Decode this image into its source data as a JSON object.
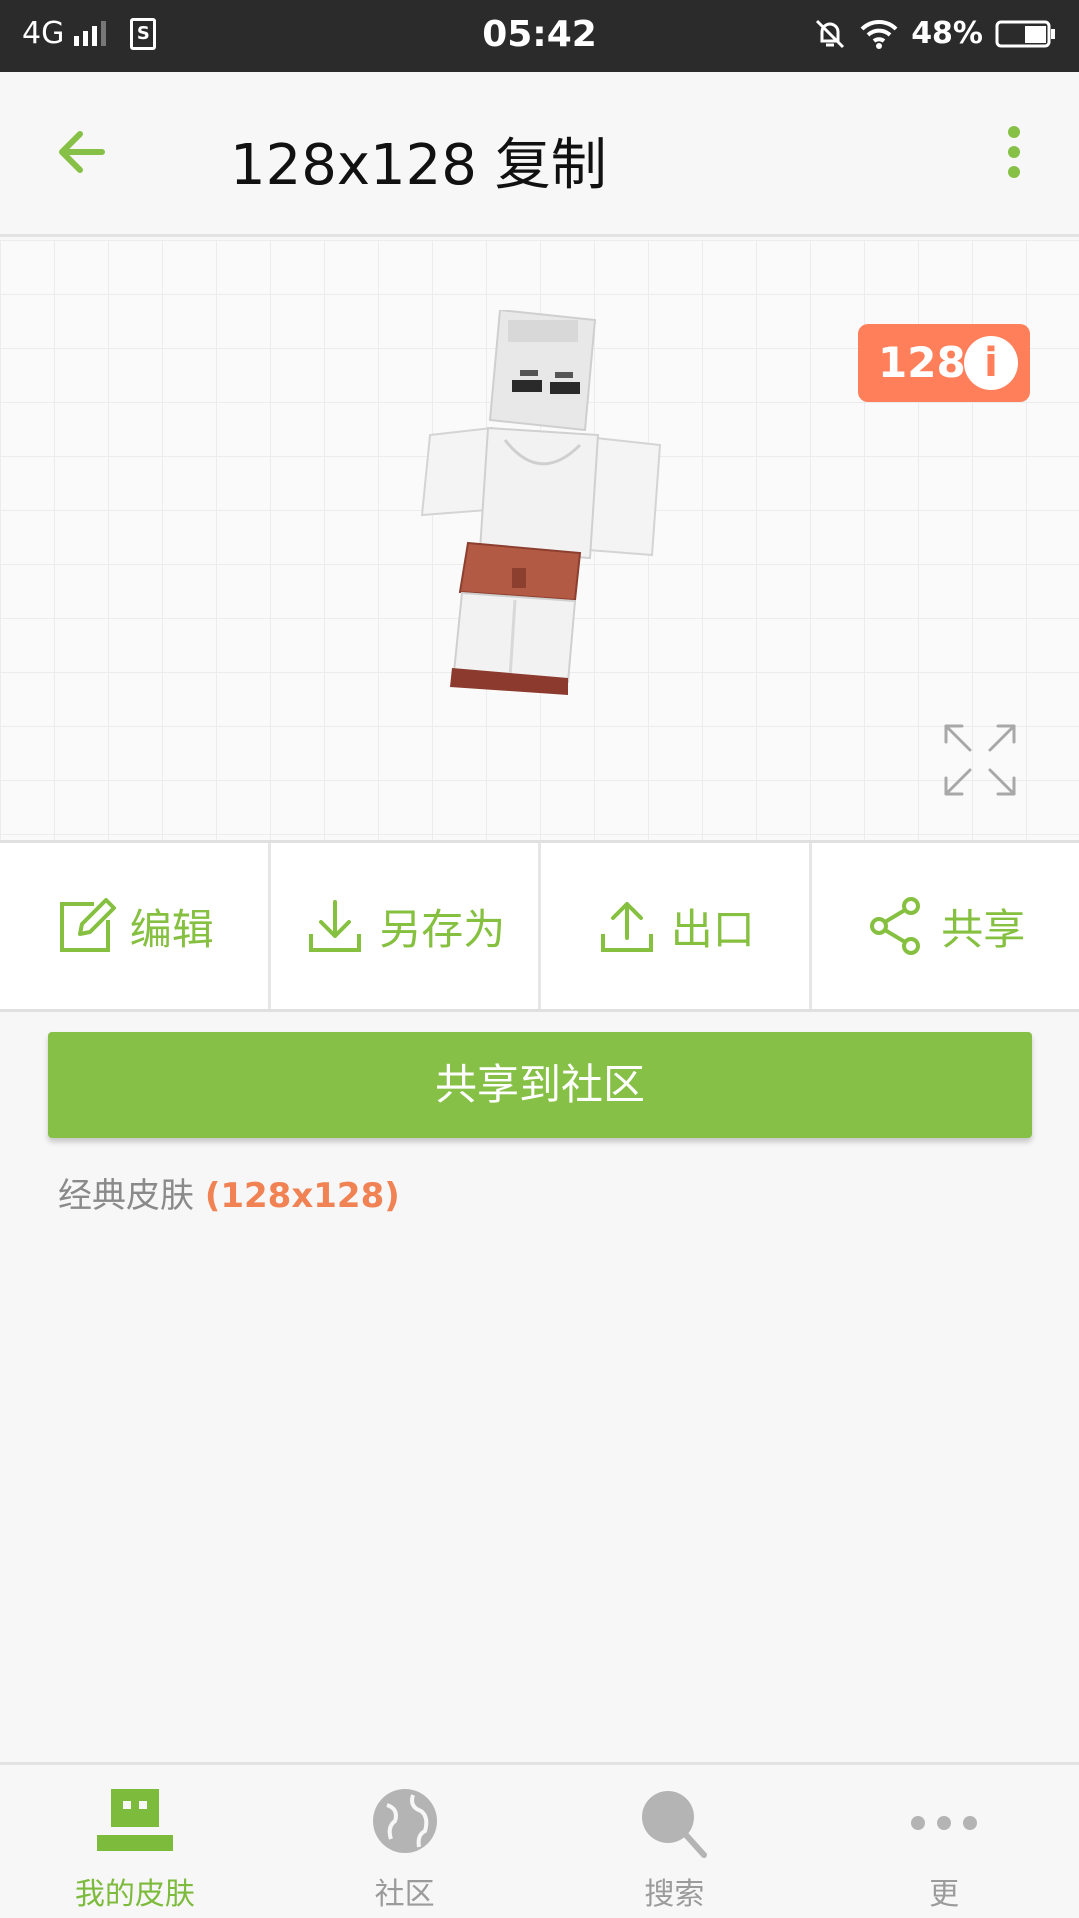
{
  "status_bar": {
    "network": "4G",
    "sim_label": "S",
    "time": "05:42",
    "battery": "48%"
  },
  "app_bar": {
    "title": "128x128 复制",
    "back_icon": "arrow-left-icon",
    "more_icon": "more-vert-icon"
  },
  "preview": {
    "resolution_badge": "128",
    "info_glyph": "i"
  },
  "actions": [
    {
      "label": "编辑",
      "icon": "edit-icon"
    },
    {
      "label": "另存为",
      "icon": "download-icon"
    },
    {
      "label": "出口",
      "icon": "upload-icon"
    },
    {
      "label": "共享",
      "icon": "share-icon"
    }
  ],
  "share_button": "共享到社区",
  "skin_type": {
    "label": "经典皮肤",
    "resolution": "(128x128)"
  },
  "bottom_nav": [
    {
      "label": "我的皮肤",
      "icon": "my-skins-icon",
      "active": true
    },
    {
      "label": "社区",
      "icon": "globe-icon",
      "active": false
    },
    {
      "label": "搜索",
      "icon": "search-icon",
      "active": false
    },
    {
      "label": "更",
      "icon": "more-horiz-icon",
      "active": false
    }
  ],
  "colors": {
    "accent_green": "#86c046",
    "badge_orange": "#ff7f5a",
    "status_bar": "#2b2b2b"
  }
}
